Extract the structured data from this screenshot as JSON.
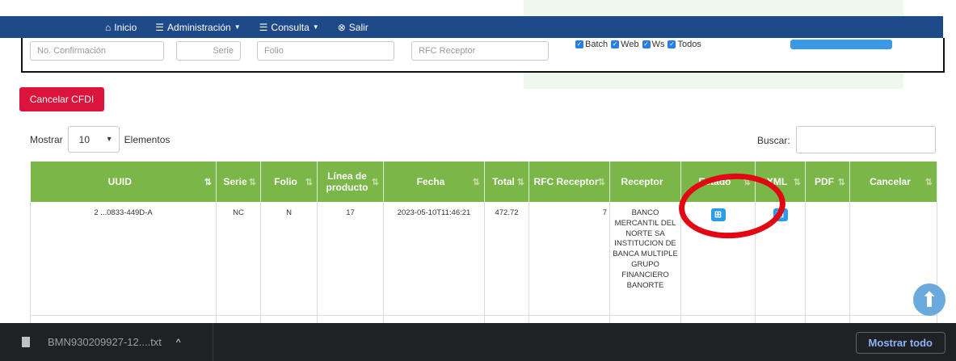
{
  "nav": {
    "items": [
      {
        "icon": "home-icon",
        "glyph": "⌂",
        "label": "Inicio",
        "caret": false
      },
      {
        "icon": "list-icon",
        "glyph": "☰",
        "label": "Administración",
        "caret": true
      },
      {
        "icon": "list-icon",
        "glyph": "☰",
        "label": "Consulta",
        "caret": true
      },
      {
        "icon": "exit-icon",
        "glyph": "⊗",
        "label": "Salir",
        "caret": false
      }
    ]
  },
  "filters": {
    "confirmacion_placeholder": "No. Confirmación",
    "serie_placeholder": "Serie",
    "folio_placeholder": "Folio",
    "rfc_placeholder": "RFC Receptor",
    "checkboxes": [
      "Batch",
      "Web",
      "Ws",
      "Todos"
    ]
  },
  "actions": {
    "cancel_cfdi": "Cancelar CFDI"
  },
  "length_menu": {
    "prefix": "Mostrar",
    "value": "10",
    "suffix": "Elementos"
  },
  "search": {
    "label": "Buscar:"
  },
  "table": {
    "headers": [
      "UUID",
      "Serie",
      "Folio",
      "Línea de producto",
      "Fecha",
      "Total",
      "RFC Receptor",
      "Receptor",
      "Estado",
      "XML",
      "PDF",
      "Cancelar"
    ],
    "rows": [
      {
        "uuid": "2 ...0833-449D-A",
        "serie": "NC",
        "folio": "N",
        "linea": "17",
        "fecha": "2023-05-10T11:46:21",
        "total": "472.72",
        "rfc": "7",
        "receptor": "BANCO MERCANTIL DEL NORTE SA INSTITUCION DE BANCA MULTIPLE GRUPO FINANCIERO BANORTE"
      }
    ]
  },
  "download_bar": {
    "file_name": "BMN930209927-12....txt",
    "show_all": "Mostrar todo"
  },
  "colors": {
    "navbar": "#1e4a8a",
    "table_header": "#7ab648",
    "cancel_button": "#dc143c",
    "action_button": "#2a9de8",
    "annotation": "#e30613"
  }
}
